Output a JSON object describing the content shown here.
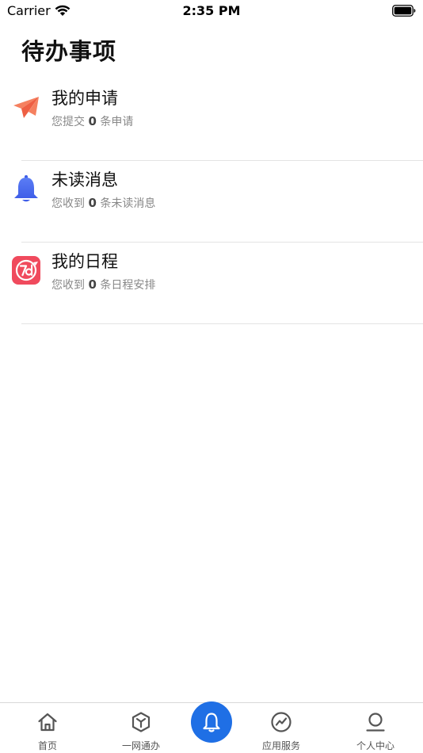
{
  "status_bar": {
    "carrier": "Carrier",
    "time": "2:35 PM"
  },
  "page": {
    "title": "待办事项"
  },
  "items": [
    {
      "title": "我的申请",
      "sub_prefix": "您提交",
      "count": "0",
      "sub_suffix": "条申请",
      "icon": "paper-plane-icon",
      "icon_color": "#f26b4f"
    },
    {
      "title": "未读消息",
      "sub_prefix": "您收到",
      "count": "0",
      "sub_suffix": "条未读消息",
      "icon": "bell-icon",
      "icon_color": "#4a6cf0"
    },
    {
      "title": "我的日程",
      "sub_prefix": "您收到",
      "count": "0",
      "sub_suffix": "条日程安排",
      "icon": "calendar-7d-icon",
      "icon_color": "#f04a5d"
    }
  ],
  "tabs": [
    {
      "label": "首页",
      "icon": "home-icon"
    },
    {
      "label": "一网通办",
      "icon": "cube-icon"
    },
    {
      "label": "",
      "icon": "bell-icon",
      "active": true,
      "color": "#1f6fe5"
    },
    {
      "label": "应用服务",
      "icon": "chart-icon"
    },
    {
      "label": "个人中心",
      "icon": "person-icon"
    }
  ]
}
